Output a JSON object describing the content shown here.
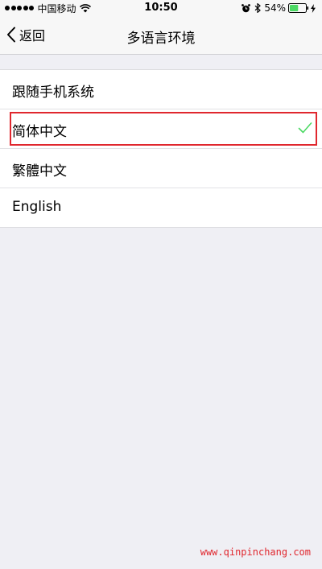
{
  "status_bar": {
    "carrier": "中国移动",
    "time": "10:50",
    "battery_percent": "54%",
    "battery_level": 0.54,
    "icons": [
      "signal-dots-icon",
      "wifi-icon",
      "alarm-icon",
      "bluetooth-icon",
      "battery-icon",
      "charging-bolt-icon"
    ]
  },
  "nav": {
    "back_label": "返回",
    "title": "多语言环境"
  },
  "options": [
    {
      "label": "跟随手机系统",
      "selected": false
    },
    {
      "label": "简体中文",
      "selected": true
    },
    {
      "label": "繁體中文",
      "selected": false
    },
    {
      "label": "English",
      "selected": false
    }
  ],
  "colors": {
    "check": "#4cd964",
    "highlight_border": "#e0272e",
    "background": "#efeff4"
  },
  "watermark": "www.qinpinchang.com"
}
